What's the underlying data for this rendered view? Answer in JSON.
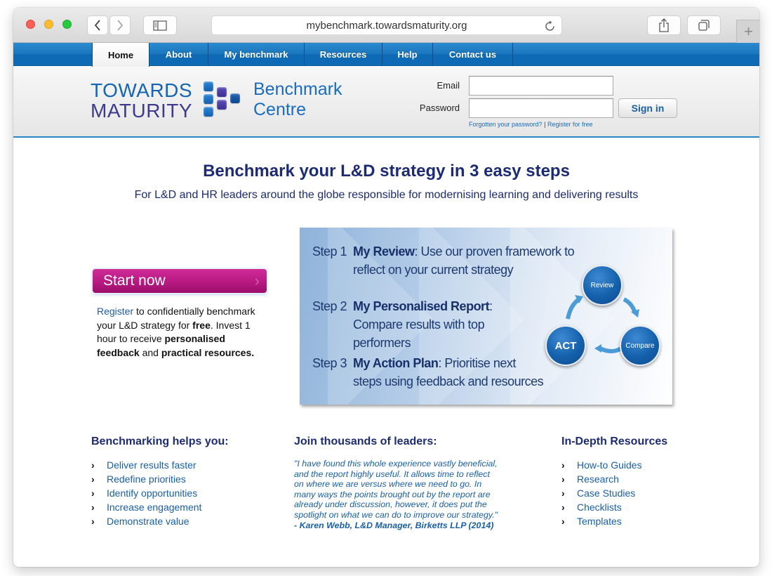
{
  "browser": {
    "url": "mybenchmark.towardsmaturity.org",
    "buttons": {
      "back": "back",
      "forward": "forward",
      "sidebar": "sidebar",
      "share": "share",
      "tabs": "tabs",
      "new_tab": "+"
    }
  },
  "nav": {
    "items": [
      {
        "label": "Home",
        "active": true
      },
      {
        "label": "About"
      },
      {
        "label": "My benchmark"
      },
      {
        "label": "Resources"
      },
      {
        "label": "Help"
      },
      {
        "label": "Contact us"
      }
    ]
  },
  "header": {
    "logo_line1": "TOWARDS",
    "logo_line2": "MATURITY",
    "product_line1": "Benchmark",
    "product_line2": "Centre",
    "email_label": "Email",
    "email_value": "",
    "password_label": "Password",
    "password_value": "",
    "signin_label": "Sign in",
    "forgot_link": "Forgotten your password?",
    "link_separator": "|",
    "register_link": "Register for free"
  },
  "hero": {
    "title": "Benchmark your L&D strategy in 3 easy steps",
    "subtitle": "For L&D and HR leaders around the globe responsible for modernising learning and delivering results"
  },
  "cta": {
    "start_label": "Start now",
    "register_link": "Register",
    "text_1": " to confidentially benchmark your L&D strategy for ",
    "bold_free": "free",
    "text_2": ". Invest 1 hour to receive ",
    "bold_personalised": "personalised feedback",
    "text_3": " and ",
    "bold_practical": "practical resources."
  },
  "steps": [
    {
      "num": "Step 1",
      "title": "My Review",
      "text": ": Use our proven framework to reflect on your current strategy"
    },
    {
      "num": "Step 2",
      "title": "My Personalised Report",
      "text": ": Compare results with top performers"
    },
    {
      "num": "Step 3",
      "title": "My Action Plan",
      "text": ": Prioritise next steps using feedback and resources"
    }
  ],
  "cycle": {
    "review": "Review",
    "compare": "Compare",
    "act": "ACT"
  },
  "benefits": {
    "title": "Benchmarking helps you:",
    "items": [
      "Deliver results faster",
      "Redefine priorities",
      "Identify opportunities",
      "Increase engagement",
      "Demonstrate value"
    ]
  },
  "testimonial": {
    "title": "Join thousands of leaders:",
    "quote": "\"I have found this whole experience vastly beneficial, and the report highly useful. It allows time to reflect on where we are versus where we need to go. In many ways the points brought out by the report are already under discussion, however, it does put the spotlight on what we can do to improve our strategy.\"",
    "attribution": " - Karen Webb, L&D Manager, Birketts LLP (2014)"
  },
  "resources": {
    "title": "In-Depth Resources",
    "items": [
      "How-to Guides",
      "Research",
      "Case Studies",
      "Checklists",
      "Templates"
    ]
  },
  "colors": {
    "nav_blue": "#1b77bd",
    "heading_navy": "#1c2b72",
    "link_blue": "#1a5fa8",
    "cta_magenta": "#b5177f"
  }
}
